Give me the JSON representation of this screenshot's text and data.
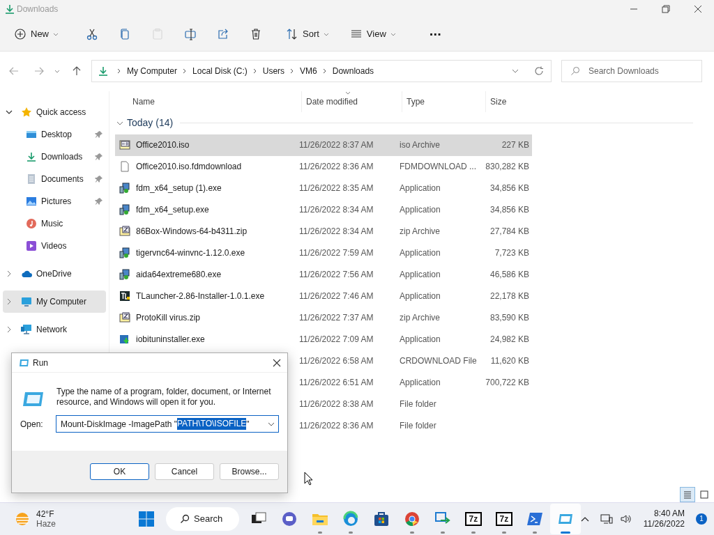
{
  "window": {
    "title": "Downloads"
  },
  "toolbar": [
    {
      "kind": "new",
      "label": "New",
      "disabled": false
    },
    {
      "kind": "cut",
      "disabled": false
    },
    {
      "kind": "copy",
      "disabled": false
    },
    {
      "kind": "paste",
      "disabled": true
    },
    {
      "kind": "rename",
      "disabled": false
    },
    {
      "kind": "share",
      "disabled": false
    },
    {
      "kind": "delete",
      "disabled": false
    },
    {
      "kind": "sort",
      "label": "Sort",
      "disabled": false
    },
    {
      "kind": "view",
      "label": "View",
      "disabled": false
    },
    {
      "kind": "more",
      "label": "···",
      "disabled": false
    }
  ],
  "breadcrumb": [
    "My Computer",
    "Local Disk (C:)",
    "Users",
    "VM6",
    "Downloads"
  ],
  "search": {
    "placeholder": "Search Downloads"
  },
  "sidebar": {
    "items": [
      {
        "kind": "star",
        "label": "Quick access",
        "expanded": true,
        "selected": false,
        "children": [
          {
            "kind": "desktop",
            "label": "Desktop",
            "pinned": true
          },
          {
            "kind": "download",
            "label": "Downloads",
            "pinned": true
          },
          {
            "kind": "documents",
            "label": "Documents",
            "pinned": true
          },
          {
            "kind": "pictures",
            "label": "Pictures",
            "pinned": true
          },
          {
            "kind": "music",
            "label": "Music",
            "pinned": false
          },
          {
            "kind": "videos",
            "label": "Videos",
            "pinned": false
          }
        ]
      },
      {
        "kind": "cloud",
        "label": "OneDrive",
        "expanded": false,
        "selected": false
      },
      {
        "kind": "computer",
        "label": "My Computer",
        "expanded": false,
        "selected": true
      },
      {
        "kind": "network",
        "label": "Network",
        "expanded": false,
        "selected": false
      }
    ]
  },
  "table": {
    "columns": [
      "Name",
      "Date modified",
      "Type",
      "Size"
    ],
    "group": {
      "label": "Today (14)",
      "expanded": true
    },
    "rows": [
      {
        "kind": "iso",
        "name": "Office2010.iso",
        "date": "11/26/2022 8:37 AM",
        "type": "iso Archive",
        "size": "227 KB",
        "selected": true
      },
      {
        "kind": "file",
        "name": "Office2010.iso.fdmdownload",
        "date": "11/26/2022 8:36 AM",
        "type": "FDMDOWNLOAD ...",
        "size": "830,282 KB",
        "selected": false
      },
      {
        "kind": "exe",
        "name": "fdm_x64_setup (1).exe",
        "date": "11/26/2022 8:35 AM",
        "type": "Application",
        "size": "34,856 KB",
        "selected": false
      },
      {
        "kind": "exe",
        "name": "fdm_x64_setup.exe",
        "date": "11/26/2022 8:34 AM",
        "type": "Application",
        "size": "34,856 KB",
        "selected": false
      },
      {
        "kind": "zip",
        "name": "86Box-Windows-64-b4311.zip",
        "date": "11/26/2022 8:34 AM",
        "type": "zip Archive",
        "size": "27,784 KB",
        "selected": false
      },
      {
        "kind": "exe",
        "name": "tigervnc64-winvnc-1.12.0.exe",
        "date": "11/26/2022 7:59 AM",
        "type": "Application",
        "size": "7,723 KB",
        "selected": false
      },
      {
        "kind": "exe",
        "name": "aida64extreme680.exe",
        "date": "11/26/2022 7:56 AM",
        "type": "Application",
        "size": "46,586 KB",
        "selected": false
      },
      {
        "kind": "tl",
        "name": "TLauncher-2.86-Installer-1.0.1.exe",
        "date": "11/26/2022 7:46 AM",
        "type": "Application",
        "size": "22,178 KB",
        "selected": false
      },
      {
        "kind": "zip",
        "name": "ProtoKill virus.zip",
        "date": "11/26/2022 7:37 AM",
        "type": "zip Archive",
        "size": "83,590 KB",
        "selected": false
      },
      {
        "kind": "installer",
        "name": "iobituninstaller.exe",
        "date": "11/26/2022 7:09 AM",
        "type": "Application",
        "size": "24,982 KB",
        "selected": false
      },
      {
        "date": "11/26/2022 6:58 AM",
        "type": "CRDOWNLOAD File",
        "size": "11,620 KB",
        "selected": false
      },
      {
        "date": "11/26/2022 6:51 AM",
        "type": "Application",
        "size": "700,722 KB",
        "selected": false
      },
      {
        "date": "11/26/2022 8:38 AM",
        "type": "File folder",
        "selected": false
      },
      {
        "date": "11/26/2022 8:36 AM",
        "type": "File folder",
        "selected": false
      }
    ]
  },
  "view_buttons": [
    {
      "kind": "details",
      "selected": true
    },
    {
      "kind": "tiles",
      "selected": false
    }
  ],
  "run_dialog": {
    "title": "Run",
    "message": "Type the name of a program, folder, document, or Internet resource, and Windows will open it for you.",
    "open_label": "Open:",
    "value_before": "Mount-DiskImage -ImagePath \"",
    "value_selected": "PATH\\TO\\ISOFILE",
    "value_after": "\"",
    "buttons": [
      {
        "label": "OK",
        "default": true
      },
      {
        "label": "Cancel",
        "default": false
      },
      {
        "label": "Browse...",
        "default": false
      }
    ]
  },
  "taskbar": {
    "weather": {
      "temperature": "42°F",
      "condition": "Haze"
    },
    "search_label": "Search",
    "apps": [
      {
        "kind": "taskview",
        "running": false,
        "active": false
      },
      {
        "kind": "chat",
        "running": false,
        "active": false
      },
      {
        "kind": "explorer",
        "running": true,
        "active": false
      },
      {
        "kind": "edge",
        "running": true,
        "active": false
      },
      {
        "kind": "store",
        "running": false,
        "active": false
      },
      {
        "kind": "chrome",
        "running": true,
        "active": false
      },
      {
        "kind": "remote",
        "running": true,
        "active": false
      },
      {
        "kind": "sevenzip",
        "label": "7z",
        "running": true,
        "active": false
      },
      {
        "kind": "sevenzip",
        "label": "7z",
        "running": true,
        "active": false
      },
      {
        "kind": "powershell",
        "running": true,
        "active": false
      },
      {
        "kind": "run",
        "running": true,
        "active": true
      }
    ],
    "time": "8:40 AM",
    "date": "11/26/2022",
    "notifications": "1"
  }
}
